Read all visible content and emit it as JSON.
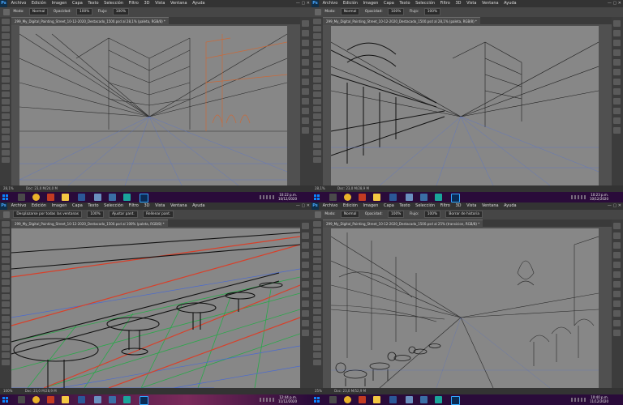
{
  "panels": [
    {
      "menu": [
        "Archivo",
        "Edición",
        "Imagen",
        "Capa",
        "Texto",
        "Selección",
        "Filtro",
        "3D",
        "Vista",
        "Ventana",
        "Ayuda"
      ],
      "options": {
        "mode_label": "Modo:",
        "mode_value": "Normal",
        "opacity_label": "Opacidad:",
        "opacity_value": "100%",
        "flow_label": "Flujo:",
        "flow_value": "100%"
      },
      "doc_tab": "299_My_Digital_Painting_Street_10-12-2020_Destacado_1500.psd al 28,1% (paleta, RGB/8) *",
      "zoom": "28,1%",
      "doc_size": "Doc: 23,0 M/24,0 M",
      "clock": {
        "time": "10:22 p.m.",
        "date": "10/12/2020"
      }
    },
    {
      "menu": [
        "Archivo",
        "Edición",
        "Imagen",
        "Capa",
        "Texto",
        "Selección",
        "Filtro",
        "3D",
        "Vista",
        "Ventana",
        "Ayuda"
      ],
      "options": {
        "mode_label": "Modo:",
        "mode_value": "Normal",
        "opacity_label": "Opacidad:",
        "opacity_value": "100%",
        "flow_label": "Flujo:",
        "flow_value": "100%"
      },
      "doc_tab": "299_My_Digital_Painting_Street_10-12-2020_Destacado_1500.psd al 28,1% (paleta, RGB/8) *",
      "zoom": "28,1%",
      "doc_size": "Doc: 23,0 M/28,9 M",
      "clock": {
        "time": "10:23 p.m.",
        "date": "10/12/2020"
      }
    },
    {
      "menu": [
        "Archivo",
        "Edición",
        "Imagen",
        "Capa",
        "Texto",
        "Selección",
        "Filtro",
        "3D",
        "Vista",
        "Ventana",
        "Ayuda"
      ],
      "options": {
        "scroll_label": "Desplazarse por todas las ventanas",
        "zoom_value": "100%",
        "fit_label": "Ajustar pant.",
        "fill_label": "Rellenar pant."
      },
      "doc_tab": "299_My_Digital_Painting_Street_10-12-2020_Destacado_1500.psd al 100% (paleta, RGB/8) *",
      "zoom": "100%",
      "doc_size": "Doc: 23,0 M/28,9 M",
      "clock": {
        "time": "12:44 p.m.",
        "date": "11/12/2020"
      }
    },
    {
      "menu": [
        "Archivo",
        "Edición",
        "Imagen",
        "Capa",
        "Texto",
        "Selección",
        "Filtro",
        "3D",
        "Vista",
        "Ventana",
        "Ayuda"
      ],
      "options": {
        "mode_label": "Modo:",
        "mode_value": "Normal",
        "opacity_label": "Opacidad:",
        "opacity_value": "100%",
        "flow_label": "Flujo:",
        "flow_value": "100%",
        "history_label": "Borrar de historia"
      },
      "doc_tab": "299_My_Digital_Painting_Street_10-12-2020_Destacado_1500.psd al 25% (transicion, RGB/8) *",
      "zoom": "25%",
      "doc_size": "Doc: 23,0 M/52,9 M",
      "clock": {
        "time": "10:40 p.m.",
        "date": "11/12/2020"
      }
    }
  ]
}
